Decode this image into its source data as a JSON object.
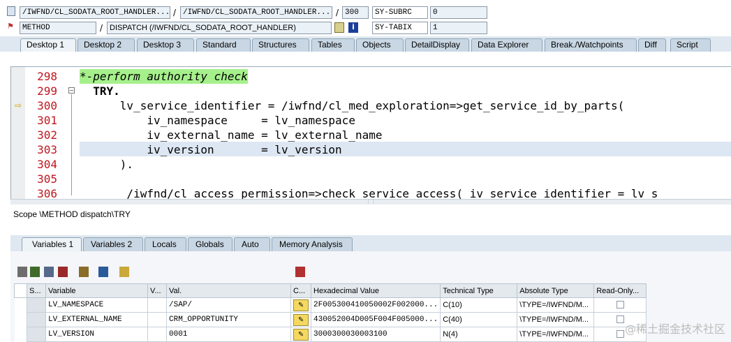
{
  "header": {
    "program": "/IWFND/CL_SODATA_ROOT_HANDLER...",
    "include": "/IWFND/CL_SODATA_ROOT_HANDLER...",
    "line": "300",
    "sy_subrc_label": "SY-SUBRC",
    "sy_subrc": "0",
    "event_type": "METHOD",
    "event": "DISPATCH (/IWFND/CL_SODATA_ROOT_HANDLER)",
    "sy_tabix_label": "SY-TABIX",
    "sy_tabix": "1",
    "sep": "/"
  },
  "tabs": [
    "Desktop 1",
    "Desktop 2",
    "Desktop 3",
    "Standard",
    "Structures",
    "Tables",
    "Objects",
    "DetailDisplay",
    "Data Explorer",
    "Break./Watchpoints",
    "Diff",
    "Script"
  ],
  "editor": {
    "lines": [
      {
        "num": "298",
        "text": "*-perform authority check"
      },
      {
        "num": "299",
        "text": "  TRY."
      },
      {
        "num": "300",
        "text": "      lv_service_identifier = /iwfnd/cl_med_exploration=>get_service_id_by_parts("
      },
      {
        "num": "301",
        "text": "          iv_namespace     = lv_namespace"
      },
      {
        "num": "302",
        "text": "          iv_external_name = lv_external_name"
      },
      {
        "num": "303",
        "text": "          iv_version       = lv_version"
      },
      {
        "num": "304",
        "text": "      )."
      },
      {
        "num": "305",
        "text": ""
      },
      {
        "num": "306",
        "text": "       /iwfnd/cl_access_permission=>check_service_access( iv_service_identifier = lv_s"
      }
    ]
  },
  "scope": "Scope \\METHOD dispatch\\TRY",
  "var_tabs": [
    "Variables 1",
    "Variables 2",
    "Locals",
    "Globals",
    "Auto",
    "Memory Analysis"
  ],
  "grid": {
    "columns": [
      "S...",
      "Variable",
      "V...",
      "Val.",
      "C...",
      "Hexadecimal Value",
      "Technical Type",
      "Absolute Type",
      "Read-Only..."
    ],
    "rows": [
      {
        "variable": "LV_NAMESPACE",
        "value": "/SAP/",
        "hex": "2F005300410050002F002000...",
        "ttype": "C(10)",
        "atype": "\\TYPE=/IWFND/M..."
      },
      {
        "variable": "LV_EXTERNAL_NAME",
        "value": "CRM_OPPORTUNITY",
        "hex": "430052004D005F004F005000...",
        "ttype": "C(40)",
        "atype": "\\TYPE=/IWFND/M..."
      },
      {
        "variable": "LV_VERSION",
        "value": "0001",
        "hex": "3000300030003100",
        "ttype": "N(4)",
        "atype": "\\TYPE=/IWFND/M..."
      }
    ]
  },
  "watermark": "@稀土掘金技术社区",
  "colors": {
    "comment_bg": "#a6f08c",
    "line_numbers": "#c0161e",
    "current_line": "#dde7f3"
  }
}
